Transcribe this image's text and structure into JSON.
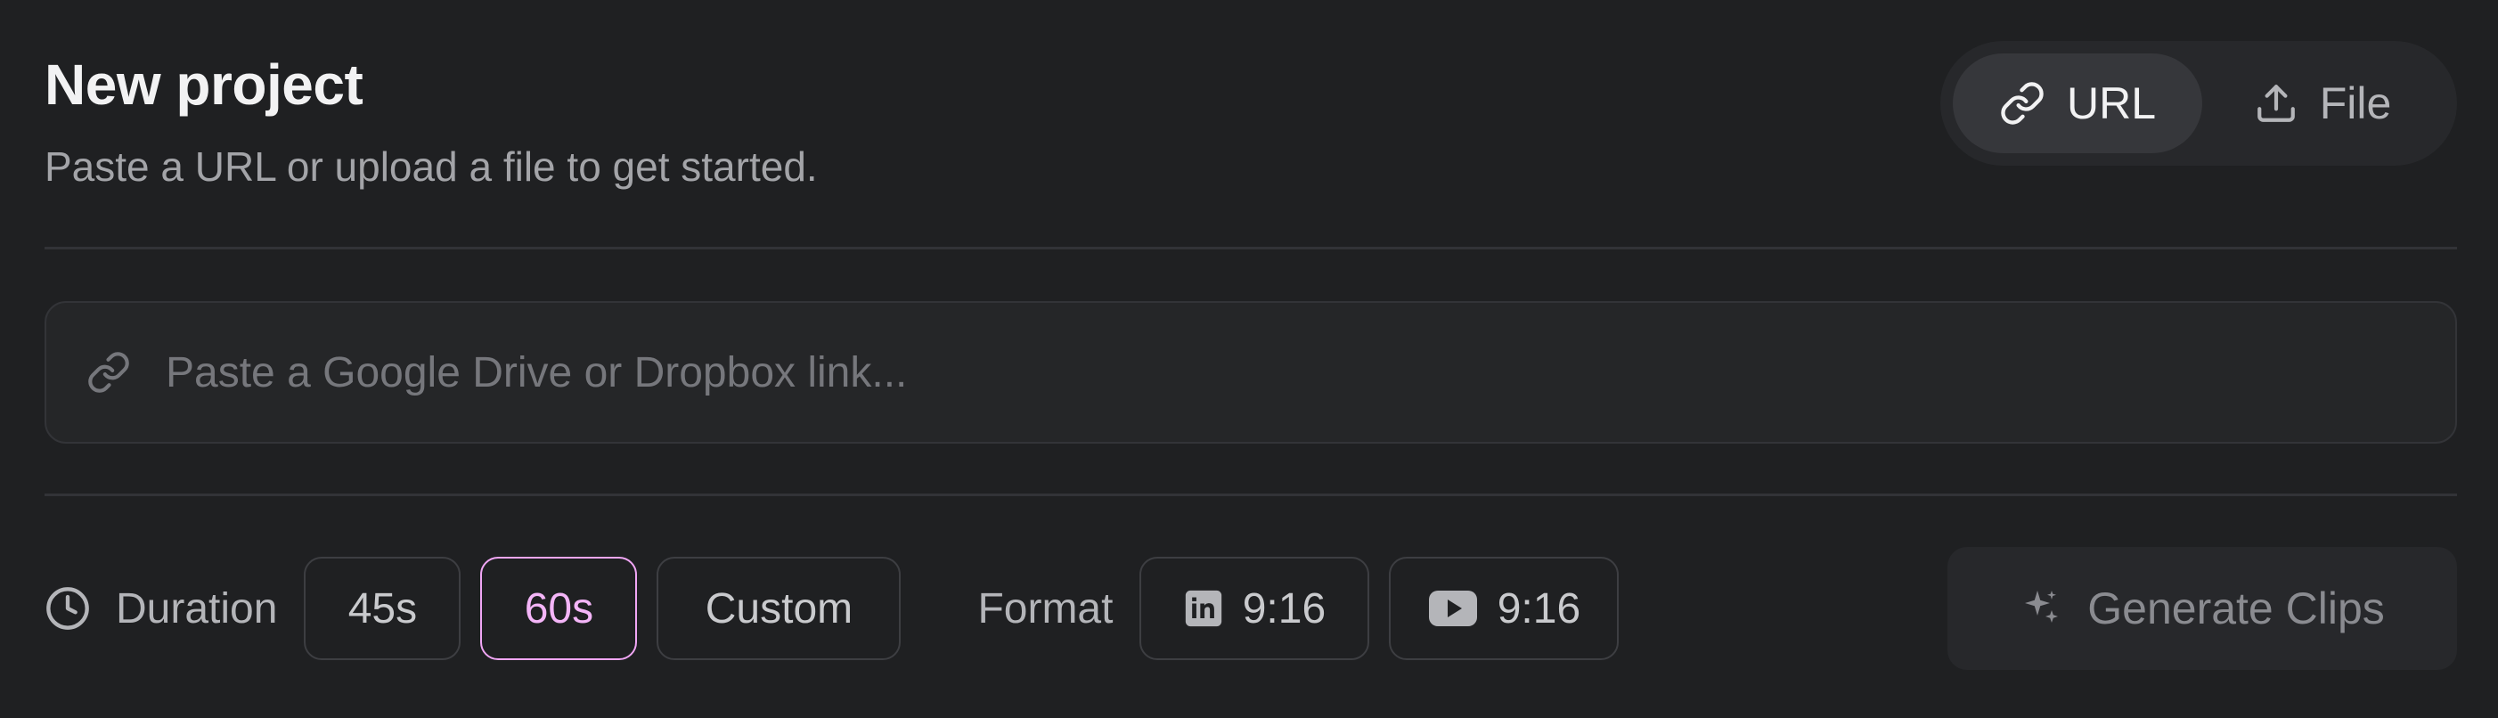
{
  "header": {
    "title": "New project",
    "subtitle": "Paste a URL or upload a file to get started."
  },
  "source_toggle": {
    "options": [
      {
        "label": "URL",
        "icon": "link-icon",
        "active": true
      },
      {
        "label": "File",
        "icon": "upload-icon",
        "active": false
      }
    ]
  },
  "url_input": {
    "value": "",
    "placeholder": "Paste a Google Drive or Dropbox link...",
    "icon": "link-icon"
  },
  "duration": {
    "label": "Duration",
    "icon": "clock-icon",
    "options": [
      "45s",
      "60s",
      "Custom"
    ],
    "selected": "60s"
  },
  "format": {
    "label": "Format",
    "options": [
      {
        "label": "9:16",
        "icon": "linkedin-icon"
      },
      {
        "label": "9:16",
        "icon": "youtube-icon"
      }
    ]
  },
  "generate": {
    "label": "Generate Clips",
    "icon": "sparkles-icon",
    "enabled": false
  },
  "colors": {
    "background": "#1f2022",
    "accent": "#f0a6f5",
    "muted_text": "#a3a4a8"
  }
}
